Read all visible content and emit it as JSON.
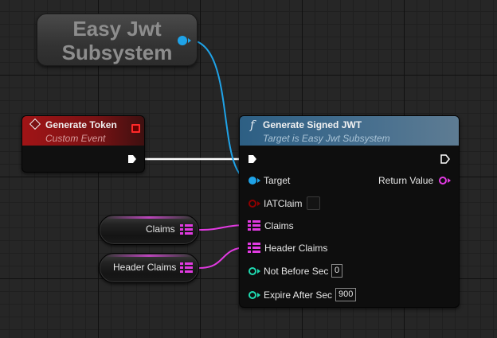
{
  "colors": {
    "exec": "#ffffff",
    "object_pin": "#1fa3e8",
    "struct_pin": "#e23ae2",
    "bool_pin": "#8e0000",
    "int_pin": "#1fd9b0",
    "event_header": "#a11416",
    "function_header": "#2d5f84"
  },
  "subsystem_node": {
    "line1": "Easy Jwt",
    "line2": "Subsystem"
  },
  "event_node": {
    "title": "Generate Token",
    "subtitle": "Custom Event",
    "icon": "event-diamond-icon"
  },
  "function_node": {
    "icon_glyph": "f",
    "title": "Generate Signed JWT",
    "subtitle": "Target is Easy Jwt Subsystem",
    "pins": {
      "target": "Target",
      "return_value": "Return Value",
      "iat_claim": "IATClaim",
      "claims": "Claims",
      "header_claims": "Header Claims",
      "not_before_sec": "Not Before Sec",
      "not_before_value": "0",
      "expire_after_sec": "Expire After Sec",
      "expire_after_value": "900"
    }
  },
  "variables": {
    "claims": "Claims",
    "header_claims": "Header Claims"
  }
}
